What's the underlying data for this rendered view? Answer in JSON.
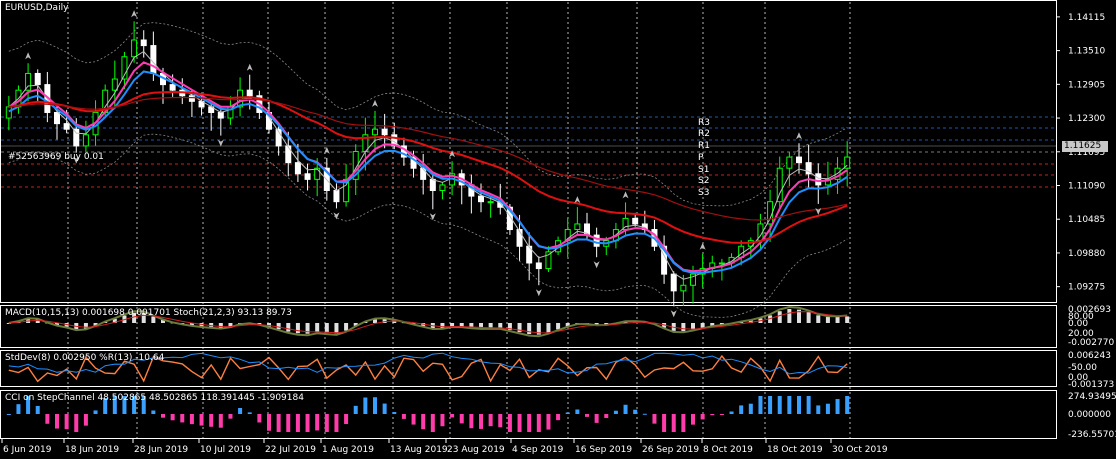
{
  "symbol_label": "EURUSD,Daily",
  "price_axis": [
    "1.14115",
    "1.13510",
    "1.12905",
    "1.12300",
    "1.11695",
    "1.11090",
    "1.10485",
    "1.09880",
    "1.09275"
  ],
  "current_price": "1.11625",
  "pivots": [
    "R3",
    "R2",
    "R1",
    "P",
    "S1",
    "S2",
    "S3"
  ],
  "order_label": "#52563969 buy 0.01",
  "indicators": {
    "macd_title": "MACD(10,15,13) 0.001698 0.001701 Stoch(21,2,3) 93.13 89.73",
    "macd_axis": [
      "0.002693",
      "80.00",
      "0.00",
      "20.00",
      "-0.002770"
    ],
    "stddev_title": "StdDev(8) 0.002950 %R(13) -10.64",
    "stddev_axis": [
      "0.006243",
      "-50.00",
      "0.00",
      "-0.001373"
    ],
    "cci_title": "CCI on StepChannel 48.502865 48.502865 118.391445 -1.909184",
    "cci_axis": [
      "274.934954",
      "0.000000",
      "-236.55701"
    ]
  },
  "time_axis": [
    "6 Jun 2019",
    "18 Jun 2019",
    "28 Jun 2019",
    "10 Jul 2019",
    "22 Jul 2019",
    "1 Aug 2019",
    "13 Aug 2019",
    "23 Aug 2019",
    "4 Sep 2019",
    "16 Sep 2019",
    "26 Sep 2019",
    "8 Oct 2019",
    "18 Oct 2019",
    "30 Oct 2019"
  ],
  "colors": {
    "background": "#000000",
    "bull_candle": "#00ff00",
    "bear_candle": "#ffffff",
    "ma_blue": "#1e90ff",
    "ma_magenta": "#ff3cb4",
    "ma_red": "#e01010",
    "stddev_line": "#ff8040",
    "cci_positive": "#3aa0ff",
    "cci_negative": "#ff3caa"
  },
  "chart_data": {
    "type": "candlestick",
    "symbol": "EURUSD",
    "timeframe": "Daily",
    "x_start": "2019-06-06",
    "x_end": "2019-11-01",
    "ylim": [
      1.09,
      1.144
    ],
    "current_price": 1.11625,
    "close_path": [
      1.125,
      1.128,
      1.131,
      1.129,
      1.124,
      1.122,
      1.121,
      1.118,
      1.12,
      1.124,
      1.128,
      1.13,
      1.134,
      1.137,
      1.136,
      1.131,
      1.129,
      1.128,
      1.127,
      1.126,
      1.125,
      1.124,
      1.123,
      1.125,
      1.128,
      1.127,
      1.124,
      1.121,
      1.118,
      1.115,
      1.113,
      1.112,
      1.114,
      1.11,
      1.108,
      1.112,
      1.117,
      1.12,
      1.121,
      1.12,
      1.118,
      1.116,
      1.114,
      1.112,
      1.11,
      1.111,
      1.113,
      1.111,
      1.109,
      1.108,
      1.108,
      1.107,
      1.103,
      1.1,
      1.097,
      1.096,
      1.099,
      1.101,
      1.103,
      1.104,
      1.102,
      1.1,
      1.101,
      1.103,
      1.105,
      1.104,
      1.103,
      1.1,
      1.095,
      1.092,
      1.093,
      1.095,
      1.096,
      1.097,
      1.097,
      1.098,
      1.1,
      1.101,
      1.104,
      1.108,
      1.114,
      1.116,
      1.115,
      1.113,
      1.111,
      1.112,
      1.114,
      1.116
    ]
  }
}
